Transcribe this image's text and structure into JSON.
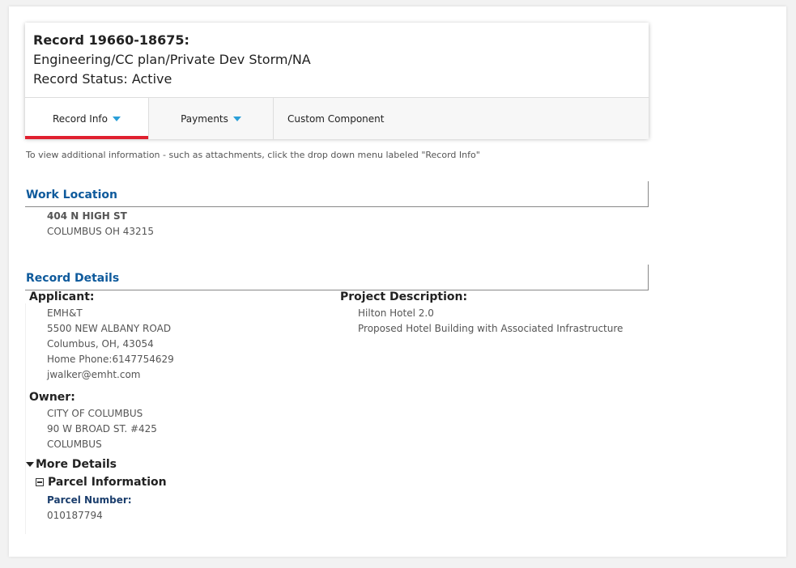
{
  "header": {
    "record_number": "Record 19660-18675:",
    "record_type": "Engineering/CC plan/Private Dev Storm/NA",
    "record_status": "Record Status: Active"
  },
  "tabs": [
    {
      "label": "Record Info",
      "active": true,
      "has_dropdown": true
    },
    {
      "label": "Payments",
      "active": false,
      "has_dropdown": true
    },
    {
      "label": "Custom Component",
      "active": false,
      "has_dropdown": false
    }
  ],
  "hint_text": "To view additional information - such as attachments, click the drop down menu labeled \"Record Info\"",
  "work_location": {
    "title": "Work Location",
    "street": "404 N HIGH ST",
    "city_line": "COLUMBUS OH 43215"
  },
  "record_details": {
    "title": "Record Details",
    "applicant": {
      "label": "Applicant:",
      "name": "EMH&T",
      "address": "5500 NEW ALBANY ROAD",
      "city": "Columbus, OH, 43054",
      "phone": "Home Phone:6147754629",
      "email": "jwalker@emht.com"
    },
    "project": {
      "label": "Project Description:",
      "name": "Hilton Hotel 2.0",
      "description": "Proposed Hotel Building with Associated Infrastructure"
    },
    "owner": {
      "label": "Owner:",
      "name": "CITY OF COLUMBUS",
      "address": "90 W BROAD ST. #425",
      "city": "COLUMBUS"
    },
    "more_details": {
      "label": "More Details",
      "parcel_info_label": "Parcel Information",
      "parcel_number_label": "Parcel Number:",
      "parcel_number": "010187794"
    }
  },
  "colors": {
    "accent_red": "#e0202f",
    "section_blue": "#0e5a9c",
    "caret_blue": "#2a9fd8"
  }
}
